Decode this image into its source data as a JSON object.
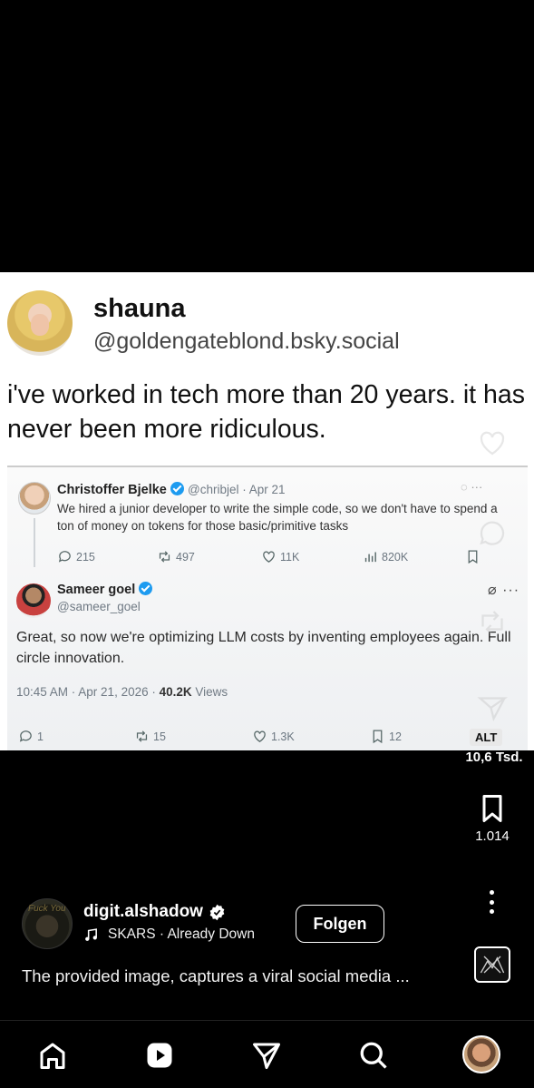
{
  "post_image": {
    "author_name": "shauna",
    "author_handle": "@goldengateblond.bsky.social",
    "text": "i've worked in tech more than 20 years. it has never been more ridiculous.",
    "quoted": {
      "original": {
        "name": "Christoffer Bjelke",
        "meta": "@chribjel · Apr 21",
        "text": "We hired a junior developer to write the simple code, so we don't have to spend a ton of money on tokens for those basic/primitive tasks",
        "replies": "215",
        "reposts": "497",
        "likes": "11K",
        "views": "820K"
      },
      "reply": {
        "name": "Sameer goel",
        "handle": "@sameer_goel",
        "text": "Great, so now we're optimizing LLM costs by inventing employees again. Full circle innovation.",
        "timestamp": "10:45 AM · Apr 21, 2026 · ",
        "views_count": "40.2K",
        "views_label": " Views",
        "replies": "1",
        "reposts": "15",
        "likes": "1.3K",
        "bookmarks": "12"
      }
    }
  },
  "reel": {
    "alt_badge": "ALT",
    "likes_count": "10,6 Tsd.",
    "saves_count": "1.014",
    "author": "digit.alshadow",
    "music": "SKARS · Already Down",
    "follow_label": "Folgen",
    "caption": "The provided image, captures a viral social media ...",
    "author_avatar_text": "Fuck You"
  },
  "icons": {
    "like": "heart-icon",
    "comment": "comment-icon",
    "repost": "repost-icon",
    "share": "share-icon",
    "save": "bookmark-icon",
    "music": "music-note-icon",
    "nav": [
      "home-icon",
      "reels-icon",
      "send-icon",
      "search-icon",
      "profile-avatar"
    ]
  },
  "colors": {
    "background": "#000000",
    "verified_blue": "#1d9bf0",
    "text_white": "#ffffff"
  }
}
